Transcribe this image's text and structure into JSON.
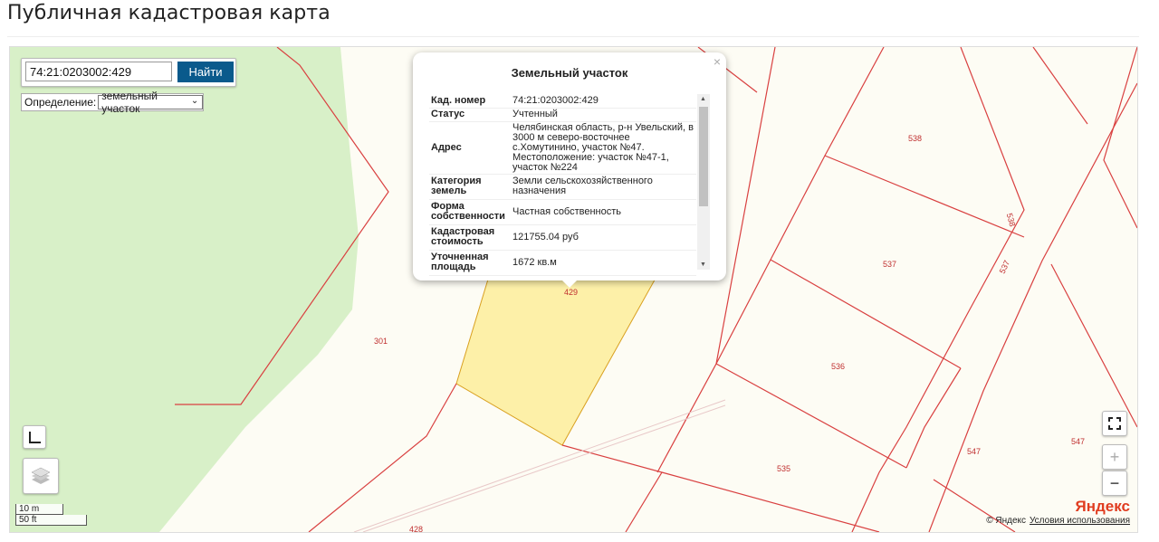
{
  "page": {
    "title": "Публичная кадастровая карта"
  },
  "search": {
    "value": "74:21:0203002:429",
    "button": "Найти"
  },
  "definition": {
    "label": "Определение:",
    "selected": "земельный участок"
  },
  "popup": {
    "title": "Земельный участок",
    "close": "×",
    "rows": [
      {
        "key": "Кад. номер",
        "value": "74:21:0203002:429"
      },
      {
        "key": "Статус",
        "value": "Учтенный"
      },
      {
        "key": "Адрес",
        "value": "Челябинская область, р-н Увельский, в 3000 м северо-восточнее с.Хомутинино, участок №47. Местоположение: участок №47-1, участок №224"
      },
      {
        "key": "Категория земель",
        "value": "Земли сельскохозяйственного назначения"
      },
      {
        "key": "Форма собственности",
        "value": "Частная собственность"
      },
      {
        "key": "Кадастровая стоимость",
        "value": "121755.04 руб"
      },
      {
        "key": "Уточненная площадь",
        "value": "1672 кв.м"
      }
    ]
  },
  "map": {
    "labels": [
      "301",
      "429",
      "428",
      "538",
      "538",
      "537",
      "537",
      "536",
      "535",
      "547",
      "547"
    ],
    "scale": {
      "top": "10 m",
      "bottom": "50 ft"
    },
    "copyright": "© Яндекс",
    "terms": "Условия использования",
    "logo": "Яндекс",
    "zoom_in": "+",
    "zoom_out": "−",
    "colors": {
      "parcel_border": "#d94040",
      "forest": "#d8f0c8",
      "selected": "#fdf0a8",
      "background": "#fdfcf4"
    }
  }
}
